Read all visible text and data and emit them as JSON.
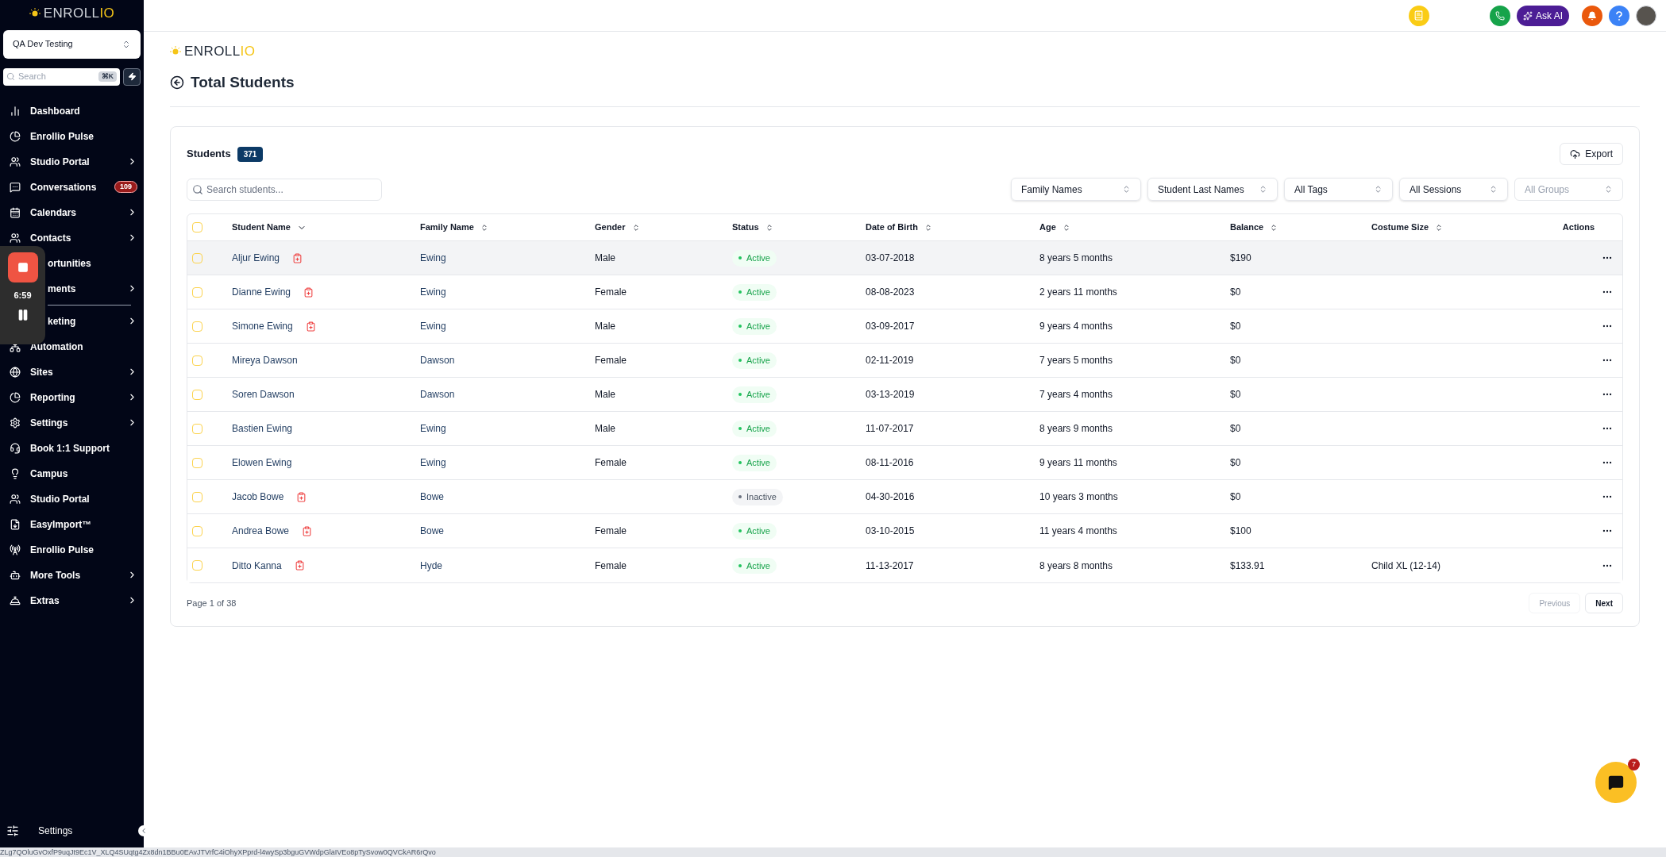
{
  "sidebar": {
    "logo": {
      "text": "ENROLL",
      "accent": "IO"
    },
    "account": "QA Dev Testing",
    "search": {
      "placeholder": "Search",
      "shortcut": "⌘K"
    },
    "items": [
      {
        "label": "Dashboard",
        "submenu": false,
        "kind": "full"
      },
      {
        "label": "Enrollio Pulse",
        "submenu": false,
        "kind": "full"
      },
      {
        "label": "Studio Portal",
        "submenu": true,
        "kind": "full"
      },
      {
        "label": "Conversations",
        "submenu": false,
        "kind": "full",
        "badge": "109"
      },
      {
        "label": "Calendars",
        "submenu": true,
        "kind": "full"
      },
      {
        "label": "Contacts",
        "submenu": true,
        "kind": "full"
      },
      {
        "label": "ortunities",
        "submenu": false,
        "kind": "partial"
      },
      {
        "label": "ments",
        "submenu": true,
        "kind": "partial",
        "divider_after": true
      },
      {
        "label": "keting",
        "submenu": true,
        "kind": "partial"
      },
      {
        "label": "Automation",
        "submenu": false,
        "kind": "full"
      },
      {
        "label": "Sites",
        "submenu": true,
        "kind": "full"
      },
      {
        "label": "Reporting",
        "submenu": true,
        "kind": "full"
      },
      {
        "label": "Settings",
        "submenu": true,
        "kind": "full"
      },
      {
        "label": "Book 1:1 Support",
        "submenu": false,
        "kind": "full"
      },
      {
        "label": "Campus",
        "submenu": false,
        "kind": "full"
      },
      {
        "label": "Studio Portal",
        "submenu": false,
        "kind": "full"
      },
      {
        "label": "EasyImport™",
        "submenu": false,
        "kind": "full"
      },
      {
        "label": "Enrollio Pulse",
        "submenu": false,
        "kind": "full"
      },
      {
        "label": "More Tools",
        "submenu": true,
        "kind": "full"
      },
      {
        "label": "Extras",
        "submenu": true,
        "kind": "full"
      }
    ],
    "footer": "Settings"
  },
  "recorder": {
    "time": "6:59"
  },
  "topbar": {
    "ask_ai": "Ask AI"
  },
  "page": {
    "logo": {
      "text": "ENROLL",
      "accent": "IO"
    },
    "title": "Total Students"
  },
  "students": {
    "title": "Students",
    "count": "371",
    "export": "Export",
    "search": {
      "placeholder": "Search students..."
    },
    "filters": [
      {
        "label": "Family Names",
        "disabled": false
      },
      {
        "label": "Student Last Names",
        "disabled": false
      },
      {
        "label": "All Tags",
        "disabled": false
      },
      {
        "label": "All Sessions",
        "disabled": false
      },
      {
        "label": "All Groups",
        "disabled": true
      }
    ],
    "all_checked": false,
    "columns": [
      {
        "label": "Student Name",
        "sorted": true
      },
      {
        "label": "Family Name",
        "sorted": false
      },
      {
        "label": "Gender",
        "sorted": false
      },
      {
        "label": "Status",
        "sorted": false
      },
      {
        "label": "Date of Birth",
        "sorted": false
      },
      {
        "label": "Age",
        "sorted": false
      },
      {
        "label": "Balance",
        "sorted": false
      },
      {
        "label": "Costume Size",
        "sorted": false
      },
      {
        "label": "Actions"
      }
    ],
    "rows": [
      {
        "name": "Aljur Ewing",
        "flagged": true,
        "family": "Ewing",
        "gender": "Male",
        "status": "Active",
        "active": true,
        "dob": "03-07-2018",
        "age": "8 years 5 months",
        "balance": "$190",
        "checked": false,
        "hovered": true
      },
      {
        "name": "Dianne Ewing",
        "flagged": true,
        "family": "Ewing",
        "gender": "Female",
        "status": "Active",
        "active": true,
        "dob": "08-08-2023",
        "age": "2 years 11 months",
        "balance": "$0",
        "checked": false,
        "hovered": false
      },
      {
        "name": "Simone Ewing",
        "flagged": true,
        "family": "Ewing",
        "gender": "Male",
        "status": "Active",
        "active": true,
        "dob": "03-09-2017",
        "age": "9 years 4 months",
        "balance": "$0",
        "checked": false,
        "hovered": false
      },
      {
        "name": "Mireya Dawson",
        "flagged": false,
        "family": "Dawson",
        "gender": "Female",
        "status": "Active",
        "active": true,
        "dob": "02-11-2019",
        "age": "7 years 5 months",
        "balance": "$0",
        "checked": false,
        "hovered": false
      },
      {
        "name": "Soren Dawson",
        "flagged": false,
        "family": "Dawson",
        "gender": "Male",
        "status": "Active",
        "active": true,
        "dob": "03-13-2019",
        "age": "7 years 4 months",
        "balance": "$0",
        "checked": false,
        "hovered": false
      },
      {
        "name": "Bastien Ewing",
        "flagged": false,
        "family": "Ewing",
        "gender": "Male",
        "status": "Active",
        "active": true,
        "dob": "11-07-2017",
        "age": "8 years 9 months",
        "balance": "$0",
        "checked": false,
        "hovered": false
      },
      {
        "name": "Elowen Ewing",
        "flagged": false,
        "family": "Ewing",
        "gender": "Female",
        "status": "Active",
        "active": true,
        "dob": "08-11-2016",
        "age": "9 years 11 months",
        "balance": "$0",
        "checked": false,
        "hovered": false
      },
      {
        "name": "Jacob Bowe",
        "flagged": true,
        "family": "Bowe",
        "status": "Inactive",
        "active": false,
        "dob": "04-30-2016",
        "age": "10 years 3 months",
        "balance": "$0",
        "checked": false,
        "hovered": false
      },
      {
        "name": "Andrea Bowe",
        "flagged": true,
        "family": "Bowe",
        "gender": "Female",
        "status": "Active",
        "active": true,
        "dob": "03-10-2015",
        "age": "11 years 4 months",
        "balance": "$100",
        "checked": false,
        "hovered": false
      },
      {
        "name": "Ditto Kanna",
        "flagged": true,
        "family": "Hyde",
        "gender": "Female",
        "status": "Active",
        "active": true,
        "dob": "11-13-2017",
        "age": "8 years 8 months",
        "balance": "$133.91",
        "costume": "Child XL (12-14)",
        "checked": false,
        "hovered": false
      }
    ],
    "pagination": {
      "info": "Page 1 of 38",
      "previous": {
        "label": "Previous",
        "disabled": true
      },
      "next": {
        "label": "Next",
        "disabled": false
      }
    }
  },
  "chat": {
    "badge": "7"
  },
  "status_url": "ZLg7QOluGvOxfP9uqJt9Ec1V_XLQ4SUqtg4Zx8dn1BBu0EAvJTVrfC4iOhyXPprd-l4wySp3bguGVWdpGlaIVEo8pTySvow0QVCkAR6rQvo"
}
